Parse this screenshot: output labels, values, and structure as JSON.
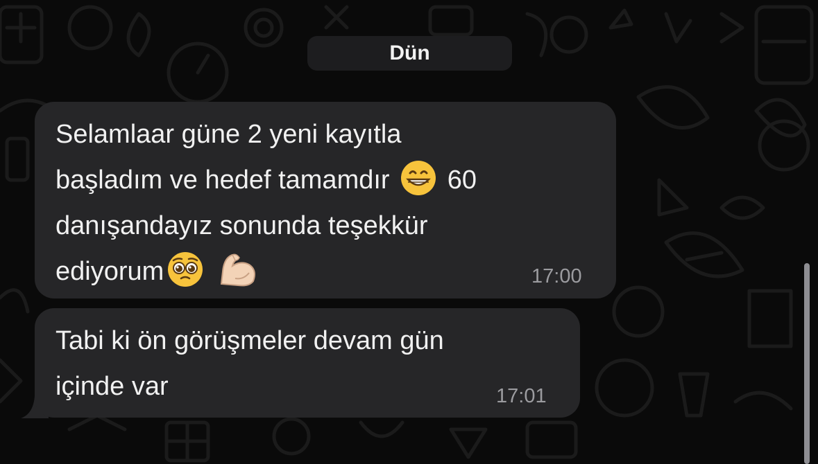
{
  "chat": {
    "date_separator": "Dün",
    "messages": [
      {
        "lines": [
          [
            "Selamlaar güne 2 yeni kayıtla"
          ],
          [
            "başladım ve hedef tamamdır ",
            "{grin}",
            " 60"
          ],
          [
            "danışandayız sonunda teşekkür"
          ],
          [
            "ediyorum",
            "{pleading}",
            "{muscle}"
          ]
        ],
        "line_texts": [
          "Selamlaar güne 2 yeni kayıtla",
          "başladım ve hedef tamamdır",
          "60",
          "danışandayız sonunda teşekkür",
          "ediyorum"
        ],
        "time": "17:00"
      },
      {
        "line_texts": [
          "Tabi ki ön görüşmeler devam gün",
          "içinde var"
        ],
        "time": "17:01"
      }
    ],
    "emoji_icons": [
      "grinning-face-icon",
      "pleading-face-icon",
      "flexed-biceps-icon"
    ]
  },
  "colors": {
    "background": "#0a0a0a",
    "bubble": "#262628",
    "text": "#f1f1f1",
    "timestamp": "#9c9ca0",
    "date_pill": "#1d1d1f"
  }
}
